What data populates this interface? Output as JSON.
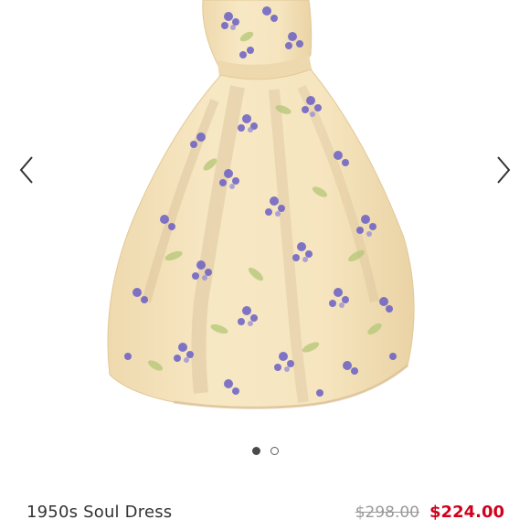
{
  "product": {
    "title": "1950s Soul Dress",
    "original_price": "$298.00",
    "sale_price": "$224.00",
    "image_description": "watercolor-illustration-of-cream-dress-with-purple-violet-floral-print"
  },
  "carousel": {
    "prev_icon": "chevron-left-icon",
    "next_icon": "chevron-right-icon",
    "slide_count": 2,
    "active_slide": 1
  },
  "colors": {
    "sale": "#d0021b",
    "original": "#9a9a9a",
    "dress": "#f5e4bd",
    "flower": "#6a5fc6"
  }
}
